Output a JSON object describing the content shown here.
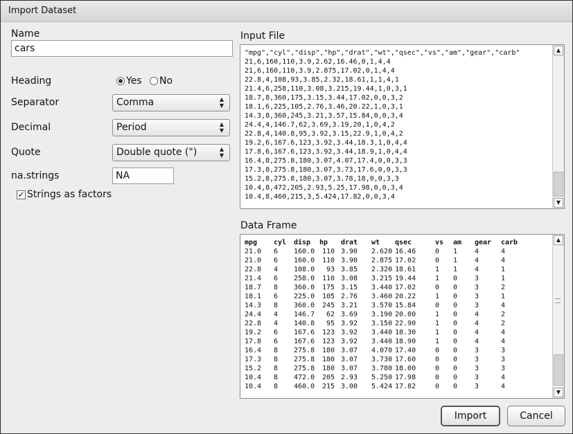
{
  "window": {
    "title": "Import Dataset"
  },
  "form": {
    "name_label": "Name",
    "name_value": "cars",
    "heading_label": "Heading",
    "heading_options": [
      "Yes",
      "No"
    ],
    "separator_label": "Separator",
    "separator_value": "Comma",
    "decimal_label": "Decimal",
    "decimal_value": "Period",
    "quote_label": "Quote",
    "quote_value": "Double quote (\")",
    "na_label": "na.strings",
    "na_value": "NA",
    "strings_as_factors_label": "Strings as factors"
  },
  "input_file": {
    "label": "Input File",
    "lines": [
      "\"mpg\",\"cyl\",\"disp\",\"hp\",\"drat\",\"wt\",\"qsec\",\"vs\",\"am\",\"gear\",\"carb\"",
      "21,6,160,110,3.9,2.62,16.46,0,1,4,4",
      "21,6,160,110,3.9,2.875,17.02,0,1,4,4",
      "22.8,4,108,93,3.85,2.32,18.61,1,1,4,1",
      "21.4,6,258,110,3.08,3.215,19.44,1,0,3,1",
      "18.7,8,360,175,3.15,3.44,17.02,0,0,3,2",
      "18.1,6,225,105,2.76,3.46,20.22,1,0,3,1",
      "14.3,8,360,245,3.21,3.57,15.84,0,0,3,4",
      "24.4,4,146.7,62,3.69,3.19,20,1,0,4,2",
      "22.8,4,140.8,95,3.92,3.15,22.9,1,0,4,2",
      "19.2,6,167.6,123,3.92,3.44,18.3,1,0,4,4",
      "17.8,6,167.6,123,3.92,3.44,18.9,1,0,4,4",
      "16.4,8,275.8,180,3.07,4.07,17.4,0,0,3,3",
      "17.3,8,275.8,180,3.07,3.73,17.6,0,0,3,3",
      "15.2,8,275.8,180,3.07,3.78,18,0,0,3,3",
      "10.4,8,472,205,2.93,5.25,17.98,0,0,3,4",
      "10.4,8,460,215,3,5.424,17.82,0,0,3,4"
    ]
  },
  "data_frame": {
    "label": "Data Frame",
    "columns": [
      "mpg",
      "cyl",
      "disp",
      "hp",
      "drat",
      "wt",
      "qsec",
      "vs",
      "am",
      "gear",
      "carb"
    ],
    "rows": [
      [
        "21.0",
        "6",
        "160.0",
        "110",
        "3.90",
        "2.620",
        "16.46",
        "0",
        "1",
        "4",
        "4"
      ],
      [
        "21.0",
        "6",
        "160.0",
        "110",
        "3.90",
        "2.875",
        "17.02",
        "0",
        "1",
        "4",
        "4"
      ],
      [
        "22.8",
        "4",
        "108.0",
        "93",
        "3.85",
        "2.320",
        "18.61",
        "1",
        "1",
        "4",
        "1"
      ],
      [
        "21.4",
        "6",
        "258.0",
        "110",
        "3.08",
        "3.215",
        "19.44",
        "1",
        "0",
        "3",
        "1"
      ],
      [
        "18.7",
        "8",
        "360.0",
        "175",
        "3.15",
        "3.440",
        "17.02",
        "0",
        "0",
        "3",
        "2"
      ],
      [
        "18.1",
        "6",
        "225.0",
        "105",
        "2.76",
        "3.460",
        "20.22",
        "1",
        "0",
        "3",
        "1"
      ],
      [
        "14.3",
        "8",
        "360.0",
        "245",
        "3.21",
        "3.570",
        "15.84",
        "0",
        "0",
        "3",
        "4"
      ],
      [
        "24.4",
        "4",
        "146.7",
        "62",
        "3.69",
        "3.190",
        "20.00",
        "1",
        "0",
        "4",
        "2"
      ],
      [
        "22.8",
        "4",
        "140.8",
        "95",
        "3.92",
        "3.150",
        "22.90",
        "1",
        "0",
        "4",
        "2"
      ],
      [
        "19.2",
        "6",
        "167.6",
        "123",
        "3.92",
        "3.440",
        "18.30",
        "1",
        "0",
        "4",
        "4"
      ],
      [
        "17.8",
        "6",
        "167.6",
        "123",
        "3.92",
        "3.440",
        "18.90",
        "1",
        "0",
        "4",
        "4"
      ],
      [
        "16.4",
        "8",
        "275.8",
        "180",
        "3.07",
        "4.070",
        "17.40",
        "0",
        "0",
        "3",
        "3"
      ],
      [
        "17.3",
        "8",
        "275.8",
        "180",
        "3.07",
        "3.730",
        "17.60",
        "0",
        "0",
        "3",
        "3"
      ],
      [
        "15.2",
        "8",
        "275.8",
        "180",
        "3.07",
        "3.780",
        "18.00",
        "0",
        "0",
        "3",
        "3"
      ],
      [
        "10.4",
        "8",
        "472.0",
        "205",
        "2.93",
        "5.250",
        "17.98",
        "0",
        "0",
        "3",
        "4"
      ],
      [
        "10.4",
        "8",
        "460.0",
        "215",
        "3.00",
        "5.424",
        "17.82",
        "0",
        "0",
        "3",
        "4"
      ]
    ]
  },
  "buttons": {
    "import": "Import",
    "cancel": "Cancel"
  }
}
